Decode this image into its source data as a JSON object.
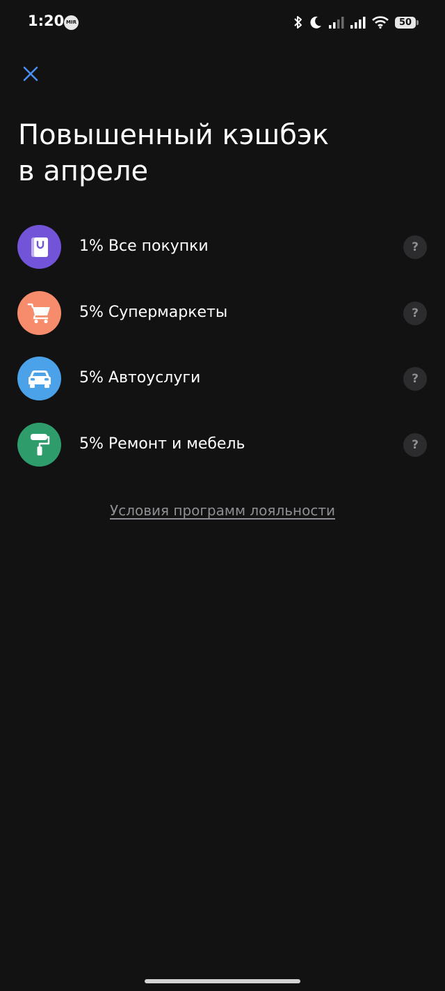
{
  "status_bar": {
    "time": "1:20",
    "badge": "MIR",
    "battery": "50",
    "icons": [
      "bluetooth-icon",
      "moon-icon",
      "signal-icon",
      "signal-icon",
      "wifi-icon",
      "battery-icon"
    ]
  },
  "header": {
    "close_icon": "close-icon",
    "title_line_1": "Повышенный кэшбэк",
    "title_line_2": "в апреле"
  },
  "categories": [
    {
      "label": "1% Все покупки",
      "icon": "shopping-bag-icon",
      "color": "#7254d9"
    },
    {
      "label": "5% Супермаркеты",
      "icon": "shopping-cart-icon",
      "color": "#f68c6b"
    },
    {
      "label": "5% Автоуслуги",
      "icon": "car-icon",
      "color": "#4ca2e8"
    },
    {
      "label": "5% Ремонт и мебель",
      "icon": "paint-roller-icon",
      "color": "#2f9c6c"
    }
  ],
  "help_label": "?",
  "loyalty_link": "Условия программ лояльности",
  "colors": {
    "background": "#121212",
    "accent": "#4a8ff0",
    "muted": "#8e8e93"
  }
}
